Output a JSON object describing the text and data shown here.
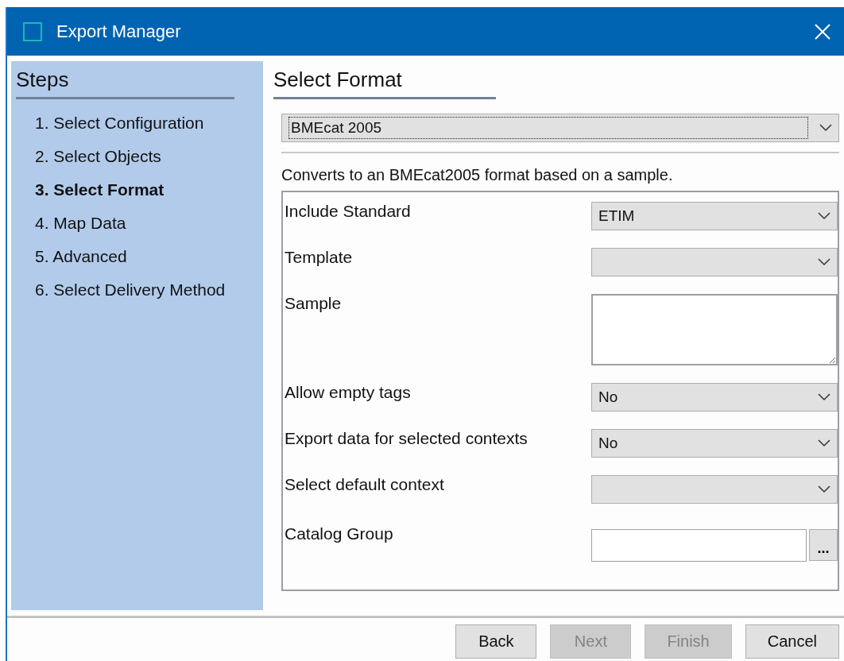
{
  "window": {
    "title": "Export Manager"
  },
  "sidebar": {
    "title": "Steps",
    "items": [
      {
        "label": "1. Select Configuration",
        "selected": false
      },
      {
        "label": "2. Select Objects",
        "selected": false
      },
      {
        "label": "3. Select Format",
        "selected": true
      },
      {
        "label": "4. Map Data",
        "selected": false
      },
      {
        "label": "5. Advanced",
        "selected": false
      },
      {
        "label": "6. Select Delivery Method",
        "selected": false
      }
    ]
  },
  "main": {
    "title": "Select Format",
    "format": {
      "value": "BMEcat 2005"
    },
    "description": "Converts to an BMEcat2005 format based on a sample.",
    "fields": [
      {
        "kind": "select",
        "label": "Include Standard",
        "value": "ETIM"
      },
      {
        "kind": "select",
        "label": "Template"
      },
      {
        "kind": "textarea",
        "label": "Sample"
      },
      {
        "kind": "select",
        "label": "Allow empty tags",
        "value": "No"
      },
      {
        "kind": "select",
        "label": "Export data for selected contexts",
        "value": "No"
      },
      {
        "kind": "select",
        "label": "Select default context"
      },
      {
        "kind": "browse",
        "label": "Catalog Group",
        "button": "..."
      }
    ]
  },
  "buttons": [
    {
      "label": "Back",
      "disabled": false
    },
    {
      "label": "Next",
      "disabled": true
    },
    {
      "label": "Finish",
      "disabled": true
    },
    {
      "label": "Cancel",
      "disabled": false
    }
  ]
}
